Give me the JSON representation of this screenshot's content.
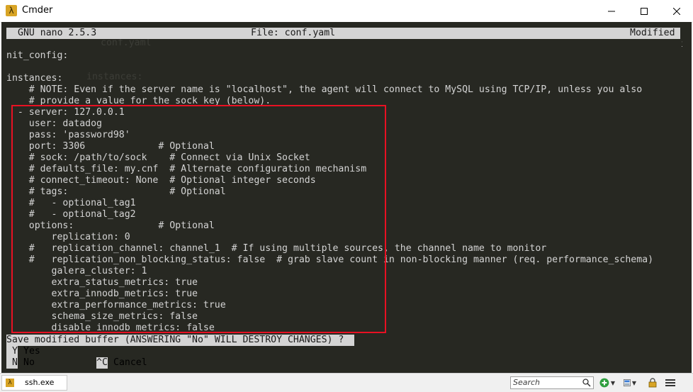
{
  "window": {
    "title": "Cmder"
  },
  "nano": {
    "version": "GNU nano 2.5.3",
    "file": "File: conf.yaml",
    "status": "Modified"
  },
  "scroll_marker": "i",
  "lines": [
    "nit_config:",
    "",
    "instances:",
    "    # NOTE: Even if the server name is \"localhost\", the agent will connect to MySQL using TCP/IP, unless you also",
    "    # provide a value for the sock key (below).",
    "  - server: 127.0.0.1",
    "    user: datadog",
    "    pass: 'password98'",
    "    port: 3306             # Optional",
    "    # sock: /path/to/sock    # Connect via Unix Socket",
    "    # defaults_file: my.cnf  # Alternate configuration mechanism",
    "    # connect_timeout: None  # Optional integer seconds",
    "    # tags:                  # Optional",
    "    #   - optional_tag1",
    "    #   - optional_tag2",
    "    options:               # Optional",
    "        replication: 0",
    "    #   replication_channel: channel_1  # If using multiple sources, the channel name to monitor",
    "    #   replication_non_blocking_status: false  # grab slave count in non-blocking manner (req. performance_schema)",
    "        galera_cluster: 1",
    "        extra_status_metrics: true",
    "        extra_innodb_metrics: true",
    "        extra_performance_metrics: true",
    "        schema_size_metrics: false",
    "        disable_innodb_metrics: false"
  ],
  "prompt": "Save modified buffer (ANSWERING \"No\" WILL DESTROY CHANGES) ?",
  "options": {
    "yes_key": "Y",
    "yes_label": "Yes",
    "no_key": "N",
    "no_label": "No",
    "cancel_key": "^C",
    "cancel_label": "Cancel"
  },
  "statusbar": {
    "tab_label": "ssh.exe",
    "search_placeholder": "Search"
  },
  "icons": {
    "app": "lambda-icon",
    "minimize": "minimize-icon",
    "maximize": "maximize-icon",
    "close": "close-icon",
    "search": "search-icon",
    "new_console": "plus-icon",
    "layout": "layout-icon",
    "lock": "lock-icon",
    "menu": "menu-icon"
  },
  "colors": {
    "terminal_bg": "#272822",
    "terminal_fg": "#d4d4d4",
    "highlight_border": "#e81123",
    "app_icon": "#d8a425"
  }
}
